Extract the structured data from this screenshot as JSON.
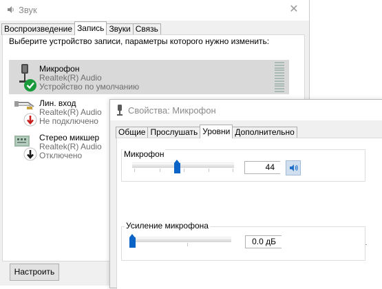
{
  "main_window": {
    "title": "Звук",
    "close_glyph": "✕",
    "tabs": [
      {
        "label": "Воспроизведение",
        "active": false
      },
      {
        "label": "Запись",
        "active": true
      },
      {
        "label": "Звуки",
        "active": false
      },
      {
        "label": "Связь",
        "active": false
      }
    ],
    "instruction": "Выберите устройство записи, параметры которого нужно изменить:",
    "devices": [
      {
        "name": "Микрофон",
        "driver": "Realtek(R) Audio",
        "status": "Устройство по умолчанию",
        "icon": "microphone-icon",
        "badge": "check-badge-icon",
        "selected": true
      },
      {
        "name": "Лин. вход",
        "driver": "Realtek(R) Audio",
        "status": "Не подключено",
        "icon": "line-in-icon",
        "badge": "arrow-down-red-badge-icon",
        "selected": false
      },
      {
        "name": "Стерео микшер",
        "driver": "Realtek(R) Audio",
        "status": "Отключено",
        "icon": "stereo-mixer-icon",
        "badge": "arrow-down-black-badge-icon",
        "selected": false
      }
    ],
    "configure_button": "Настроить"
  },
  "properties_window": {
    "title": "Свойства: Микрофон",
    "tabs": [
      {
        "label": "Общие",
        "active": false
      },
      {
        "label": "Прослушать",
        "active": false
      },
      {
        "label": "Уровни",
        "active": true
      },
      {
        "label": "Дополнительно",
        "active": false
      }
    ],
    "microphone": {
      "label": "Микрофон",
      "value": "44",
      "level_fraction": 0.44
    },
    "boost": {
      "label": "Усиление микрофона",
      "value": "0.0 дБ",
      "level_fraction": 0.0
    }
  },
  "colors": {
    "accent": "#0a64c8",
    "selection": "#d9d9d9",
    "check_green": "#1a9a3a",
    "status_red": "#c81e1e"
  }
}
